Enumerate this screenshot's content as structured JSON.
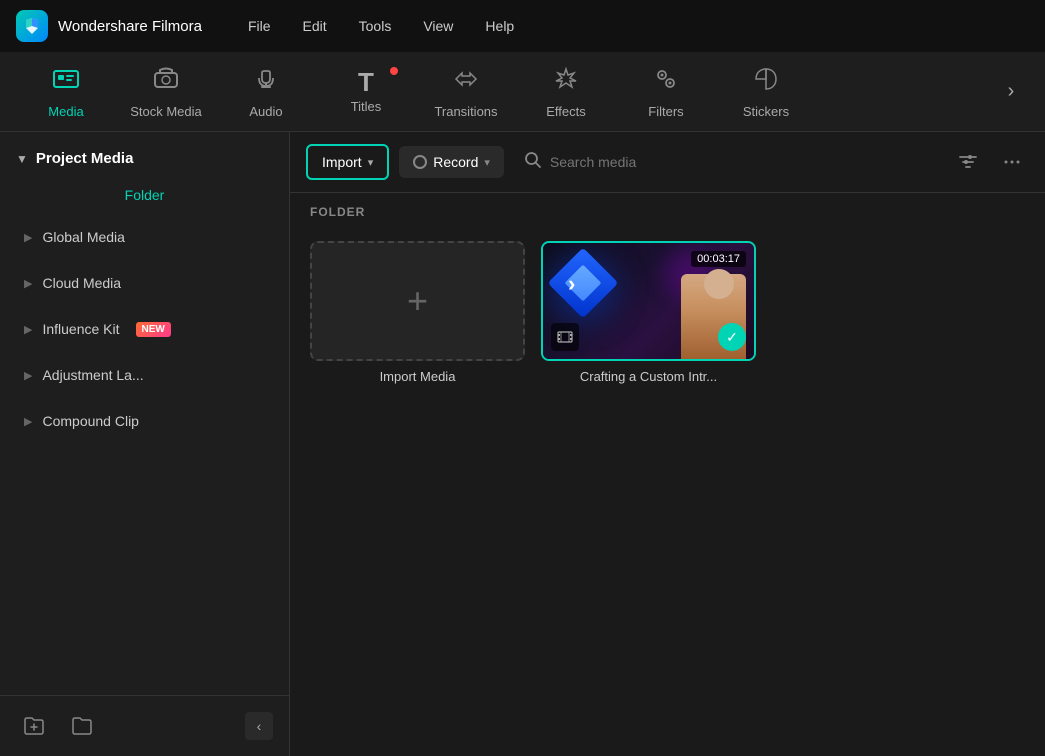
{
  "app": {
    "title": "Wondershare Filmora",
    "logo_text": "F"
  },
  "menu": {
    "items": [
      "File",
      "Edit",
      "Tools",
      "View",
      "Help"
    ]
  },
  "toolbar": {
    "items": [
      {
        "id": "media",
        "label": "Media",
        "icon": "🖼",
        "active": true,
        "badge": false
      },
      {
        "id": "stock-media",
        "label": "Stock Media",
        "icon": "☁",
        "active": false,
        "badge": false
      },
      {
        "id": "audio",
        "label": "Audio",
        "icon": "♪",
        "active": false,
        "badge": false
      },
      {
        "id": "titles",
        "label": "Titles",
        "icon": "T",
        "active": false,
        "badge": true
      },
      {
        "id": "transitions",
        "label": "Transitions",
        "icon": "↔",
        "active": false,
        "badge": false
      },
      {
        "id": "effects",
        "label": "Effects",
        "icon": "✦",
        "active": false,
        "badge": false
      },
      {
        "id": "filters",
        "label": "Filters",
        "icon": "⚙",
        "active": false,
        "badge": false
      },
      {
        "id": "stickers",
        "label": "Stickers",
        "icon": "🎀",
        "active": false,
        "badge": false
      }
    ],
    "more_icon": "›"
  },
  "sidebar": {
    "project_media_label": "Project Media",
    "folder_label": "Folder",
    "nav_items": [
      {
        "id": "global-media",
        "label": "Global Media",
        "badge": null
      },
      {
        "id": "cloud-media",
        "label": "Cloud Media",
        "badge": null
      },
      {
        "id": "influence-kit",
        "label": "Influence Kit",
        "badge": "NEW"
      },
      {
        "id": "adjustment-la",
        "label": "Adjustment La...",
        "badge": null
      },
      {
        "id": "compound-clip",
        "label": "Compound Clip",
        "badge": null
      }
    ],
    "footer": {
      "add_folder_icon": "🗁",
      "folder_icon": "📁",
      "collapse_icon": "‹"
    }
  },
  "media_area": {
    "import_label": "Import",
    "record_label": "Record",
    "search_placeholder": "Search media",
    "folder_section_label": "FOLDER",
    "items": [
      {
        "id": "import-media",
        "label": "Import Media",
        "type": "import"
      },
      {
        "id": "video-1",
        "label": "Crafting a Custom Intr...",
        "type": "video",
        "duration": "00:03:17"
      }
    ]
  }
}
